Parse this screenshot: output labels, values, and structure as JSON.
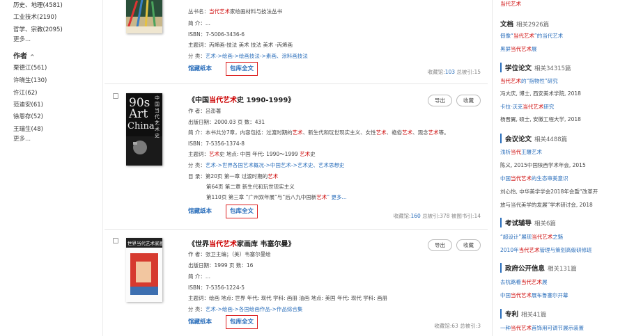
{
  "sidebar": {
    "items_top": [
      "历史、地理(4581)",
      "工业技术(2190)",
      "哲学、宗教(2095)",
      "更多..."
    ],
    "author_title": "作者",
    "author_chevron": "^",
    "authors": [
      "栗德江(561)",
      "许晓生(130)",
      "许江(62)",
      "范迪安(61)",
      "徐恩存(52)",
      "王瑞生(48)",
      "更多..."
    ]
  },
  "books": [
    {
      "series_label": "丛书名：",
      "series_pre": "",
      "series_hl": "当代艺术",
      "series_post": "家绘画材料与技法丛书",
      "intro": "简  介：...",
      "isbn": "ISBN：7-5006-3436-6",
      "subject": "主题词：丙烯画-技法 美术 技法 美术 -丙烯画",
      "category_label": "分  类：",
      "category": "艺术->绘画->绘画技法->素画、涂料画技法",
      "act_paper": "馆藏纸本",
      "act_full": "包库全文",
      "stats_pre": "收藏馆:",
      "stats_n1": "103",
      "stats_post": "  总被引:15"
    },
    {
      "title_pre": "《中国",
      "title_hl": "当代艺术",
      "title_post": "史 1990-1999》",
      "btn_export": "导出",
      "btn_fav": "收藏",
      "author": "作  者：吕澎著",
      "pubdate": "出版日期：2000.03      页  数：431",
      "intro_pre": "简  介：本书共分7章，内容包括：过渡时期的",
      "intro_hl1": "艺术",
      "intro_mid1": "、新生代和玩世现实主义、女性",
      "intro_hl2": "艺术",
      "intro_mid2": "、艳俗",
      "intro_hl3": "艺术",
      "intro_mid3": "、观念",
      "intro_hl4": "艺术",
      "intro_post": "等。",
      "isbn": "ISBN：7-5356-1374-8",
      "subject_pre": "主题词：",
      "subject_hl1": "艺术",
      "subject_mid": "史 地点: 中国 年代: 1990～1999 ",
      "subject_hl2": "艺术",
      "subject_post": "史",
      "category_label": "分  类：",
      "category": "艺术->世界各国艺术概况->中国艺术->艺术史、艺术思想史",
      "toc1_pre": "目  录：第20页 第一章 过渡时期的",
      "toc1_hl": "艺术",
      "toc2": "第64页 第二章 新生代和玩世现实主义",
      "toc3_pre": "第110页 第三章 “广州双年展”与“后八九中国新",
      "toc3_hl": "艺术",
      "toc3_post": "”  更多...",
      "act_paper": "馆藏纸本",
      "act_full": "包库全文",
      "stats_pre": "收藏馆:",
      "stats_n1": "160",
      "stats_post": "  总被引:378  被图书引:14"
    },
    {
      "title_pre": "《世界",
      "title_hl": "当代艺术",
      "title_post": "家画库 韦塞尔曼》",
      "btn_export": "导出",
      "btn_fav": "收藏",
      "author": "作  者：张卫主编；（美）韦塞尔曼绘",
      "pubdate": "出版日期：1999      页  数：16",
      "intro": "简  介：...",
      "isbn": "ISBN：7-5356-1224-5",
      "subject": "主题词：绘画 地点: 世界 年代: 现代 学科: 画册 油画 地点: 美国 年代: 现代 学科: 画册",
      "category_label": "分  类：",
      "category": "艺术->绘画->各国绘画作品->作品综合集",
      "act_paper": "馆藏纸本",
      "act_full": "包库全文",
      "stats_pre": "收藏馆:63  总被引:3",
      "stats_n1": "",
      "stats_post": ""
    }
  ],
  "covers": {
    "b2_big": "90s",
    "b2_art": "Art",
    "b2_china": "China",
    "b2_side": "中国当代艺术史",
    "b3_head": "世界当代艺术家画库"
  },
  "right": {
    "top_item": "当代艺术",
    "sections": [
      {
        "title": "文档",
        "count": "相关2926篇",
        "items": [
          {
            "pre": "假像“",
            "hl": "当代艺术",
            "post": "”的当代艺术"
          },
          {
            "pre": "黑屏",
            "hl": "当代艺术",
            "post": "展"
          }
        ]
      },
      {
        "title": "学位论文",
        "count": "相关34315篇",
        "items": [
          {
            "pre": "",
            "hl": "当代艺术",
            "post": "的“指物性”研究"
          },
          {
            "pre": "冯大庆, 博士, 西安美术学院, 2018",
            "hl": "",
            "post": "",
            "dark": true
          },
          {
            "pre": "卡拉·沃克",
            "hl": "当代艺术",
            "post": "研究"
          },
          {
            "pre": "杨晋翼, 硕士, 安徽工程大学, 2018",
            "hl": "",
            "post": "",
            "dark": true
          }
        ]
      },
      {
        "title": "会议论文",
        "count": "相关4488篇",
        "items": [
          {
            "pre": "浅析",
            "hl": "当代",
            "post": "王雕艺术"
          },
          {
            "pre": "陈义, 2015中国陕西学术年会, 2015",
            "hl": "",
            "post": "",
            "dark": true
          },
          {
            "pre": "中国",
            "hl": "当代艺术",
            "post": "的生态审美意识"
          },
          {
            "pre": "刘心怡, 中华美学学会2018年会暨“改革开",
            "hl": "",
            "post": "",
            "dark": true
          },
          {
            "pre": "放与当代美学的发展”学术研讨会, 2018",
            "hl": "",
            "post": "",
            "dark": true
          }
        ]
      },
      {
        "title": "考试辅导",
        "count": "相关6篇",
        "items": [
          {
            "pre": "“超设计”展现",
            "hl": "当代艺术",
            "post": "之魅"
          },
          {
            "pre": "2010年",
            "hl": "当代艺术",
            "post": "管理与策划高级研修班"
          }
        ]
      },
      {
        "title": "政府公开信息",
        "count": "相关131篇",
        "items": [
          {
            "pre": "去杭路看",
            "hl": "当代艺术",
            "post": "展"
          },
          {
            "pre": "中国",
            "hl": "当代艺术",
            "post": "展布鲁塞尔开幕"
          }
        ]
      },
      {
        "title": "专利",
        "count": "相关41篇",
        "items": [
          {
            "pre": "一种",
            "hl": "当代艺术",
            "post": "首饰用可调节展示装置"
          }
        ]
      }
    ]
  },
  "colors": {
    "link": "#2a6ebb",
    "highlight": "#cc0000",
    "box": "#dd2222"
  }
}
